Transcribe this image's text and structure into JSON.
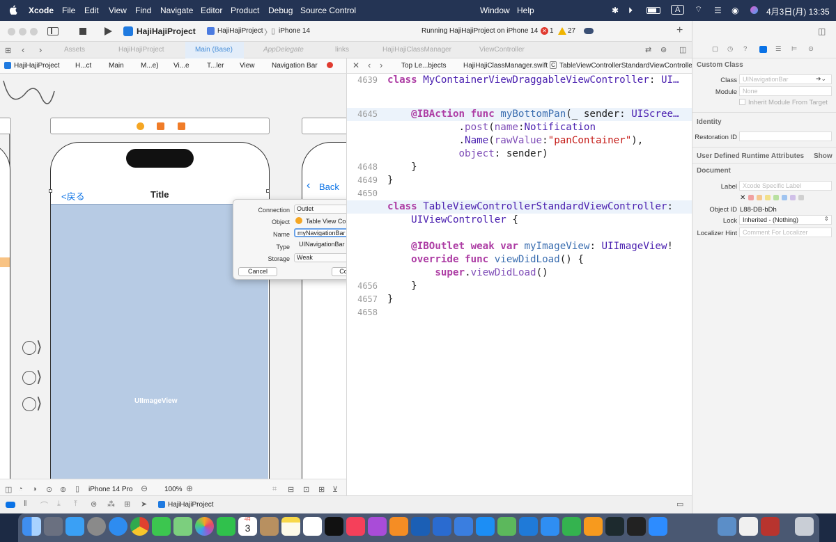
{
  "menubar": {
    "items": [
      "Xcode",
      "File",
      "Edit",
      "View",
      "Find",
      "Navigate",
      "Editor",
      "Product",
      "Debug",
      "Source Control",
      "Window",
      "Help"
    ],
    "status_a": "A",
    "clock": "4月3日(月)  13:35"
  },
  "toolbar": {
    "project_name": "HajiHajiProject",
    "scheme": "HajiHajiProject",
    "device": "iPhone 14",
    "status": "Running HajiHajiProject on iPhone 14",
    "error_count": "1",
    "warning_count": "27",
    "add": "+"
  },
  "tabs": [
    "Assets",
    "HajiHajiProject",
    "Main (Base)",
    "AppDelegate",
    "links",
    "HajiHajiClassManager",
    "ViewController"
  ],
  "left_jumpbar": [
    "HajiHajiProject",
    "H...ct",
    "Main",
    "M...e)",
    "Vi...e",
    "T...ler",
    "View",
    "Navigation Bar"
  ],
  "right_jumpbar": [
    "Top Le...bjects",
    "HajiHajiClassManager.swift",
    "TableViewControllerStandardViewController"
  ],
  "canvas": {
    "nav_back": "<戻る",
    "nav_title": "Title",
    "back_label": "Back",
    "image_view_label": "UIImageView",
    "device_label": "iPhone 14 Pro",
    "zoom": "100%"
  },
  "popover": {
    "connection_label": "Connection",
    "connection_value": "Outlet",
    "object_label": "Object",
    "object_value": "Table View Controlle...",
    "name_label": "Name",
    "name_value": "myNavigationBar",
    "type_label": "Type",
    "type_value": "UINavigationBar",
    "storage_label": "Storage",
    "storage_value": "Weak",
    "cancel": "Cancel",
    "connect": "Connect"
  },
  "code": {
    "lines": [
      {
        "n": "4639",
        "segments": [
          {
            "c": "kw",
            "t": "class "
          },
          {
            "c": "ty",
            "t": "MyContainerViewDraggableViewController"
          },
          {
            "c": "",
            "t": ": "
          },
          {
            "c": "ty",
            "t": "UI…"
          }
        ]
      },
      {
        "n": "4645",
        "segments": [
          {
            "c": "",
            "t": "    "
          },
          {
            "c": "kw",
            "t": "@IBAction func "
          },
          {
            "c": "fn",
            "t": "myBottomPan"
          },
          {
            "c": "",
            "t": "(_ sender: "
          },
          {
            "c": "ty",
            "t": "UIScree…"
          }
        ]
      },
      {
        "n": "",
        "segments": [
          {
            "c": "",
            "t": "            ."
          },
          {
            "c": "pp",
            "t": "post"
          },
          {
            "c": "",
            "t": "("
          },
          {
            "c": "pp",
            "t": "name"
          },
          {
            "c": "",
            "t": ":"
          },
          {
            "c": "ty",
            "t": "Notification"
          }
        ]
      },
      {
        "n": "",
        "segments": [
          {
            "c": "",
            "t": "            ."
          },
          {
            "c": "ty",
            "t": "Name"
          },
          {
            "c": "",
            "t": "("
          },
          {
            "c": "pp",
            "t": "rawValue"
          },
          {
            "c": "",
            "t": ":"
          },
          {
            "c": "st",
            "t": "\"panContainer\""
          },
          {
            "c": "",
            "t": "),"
          }
        ]
      },
      {
        "n": "",
        "segments": [
          {
            "c": "",
            "t": "            "
          },
          {
            "c": "pp",
            "t": "object"
          },
          {
            "c": "",
            "t": ": sender)"
          }
        ]
      },
      {
        "n": "4648",
        "segments": [
          {
            "c": "",
            "t": "    }"
          }
        ]
      },
      {
        "n": "4649",
        "segments": [
          {
            "c": "",
            "t": "}"
          }
        ]
      },
      {
        "n": "4650",
        "segments": [
          {
            "c": "",
            "t": ""
          }
        ]
      },
      {
        "n": "",
        "segments": [
          {
            "c": "kw",
            "t": "class "
          },
          {
            "c": "ty",
            "t": "TableViewControllerStandardViewController"
          },
          {
            "c": "",
            "t": ":"
          }
        ]
      },
      {
        "n": "",
        "segments": [
          {
            "c": "",
            "t": "    "
          },
          {
            "c": "ty",
            "t": "UIViewController"
          },
          {
            "c": "",
            "t": " {"
          }
        ]
      },
      {
        "n": "",
        "segments": [
          {
            "c": "",
            "t": ""
          }
        ]
      },
      {
        "n": "",
        "segments": [
          {
            "c": "",
            "t": "    "
          },
          {
            "c": "kw",
            "t": "@IBOutlet weak var "
          },
          {
            "c": "fn",
            "t": "myImageView"
          },
          {
            "c": "",
            "t": ": "
          },
          {
            "c": "ty",
            "t": "UIImageView"
          },
          {
            "c": "",
            "t": "!"
          }
        ]
      },
      {
        "n": "",
        "segments": [
          {
            "c": "",
            "t": "    "
          },
          {
            "c": "kw",
            "t": "override func "
          },
          {
            "c": "fn",
            "t": "viewDidLoad"
          },
          {
            "c": "",
            "t": "() {"
          }
        ]
      },
      {
        "n": "",
        "segments": [
          {
            "c": "",
            "t": "        "
          },
          {
            "c": "kw",
            "t": "super"
          },
          {
            "c": "",
            "t": "."
          },
          {
            "c": "pp",
            "t": "viewDidLoad"
          },
          {
            "c": "",
            "t": "()"
          }
        ]
      },
      {
        "n": "4656",
        "segments": [
          {
            "c": "",
            "t": "    }"
          }
        ]
      },
      {
        "n": "4657",
        "segments": [
          {
            "c": "",
            "t": "}"
          }
        ]
      },
      {
        "n": "4658",
        "segments": [
          {
            "c": "",
            "t": ""
          }
        ]
      }
    ]
  },
  "inspector": {
    "custom_class_header": "Custom Class",
    "class_label": "Class",
    "class_placeholder": "UINavigationBar",
    "module_label": "Module",
    "module_placeholder": "None",
    "inherit_label": "Inherit Module From Target",
    "identity_header": "Identity",
    "restoration_label": "Restoration ID",
    "udra_header": "User Defined Runtime Attributes",
    "udra_show": "Show",
    "document_header": "Document",
    "label_label": "Label",
    "label_placeholder": "Xcode Specific Label",
    "objectid_label": "Object ID",
    "objectid_value": "L88-DB-bDh",
    "lock_label": "Lock",
    "lock_value": "Inherited - (Nothing)",
    "localizer_label": "Localizer Hint",
    "localizer_placeholder": "Comment For Localizer"
  },
  "debug": {
    "target": "HajiHajiProject"
  },
  "dock": {
    "calendar_month": "4月",
    "calendar_day": "3"
  },
  "colors": {
    "menubar": "#243454",
    "image_view_fill": "#b7cbe4",
    "keyword": "#ad3da4",
    "type": "#4b21b0",
    "accent": "#0a72e6"
  }
}
